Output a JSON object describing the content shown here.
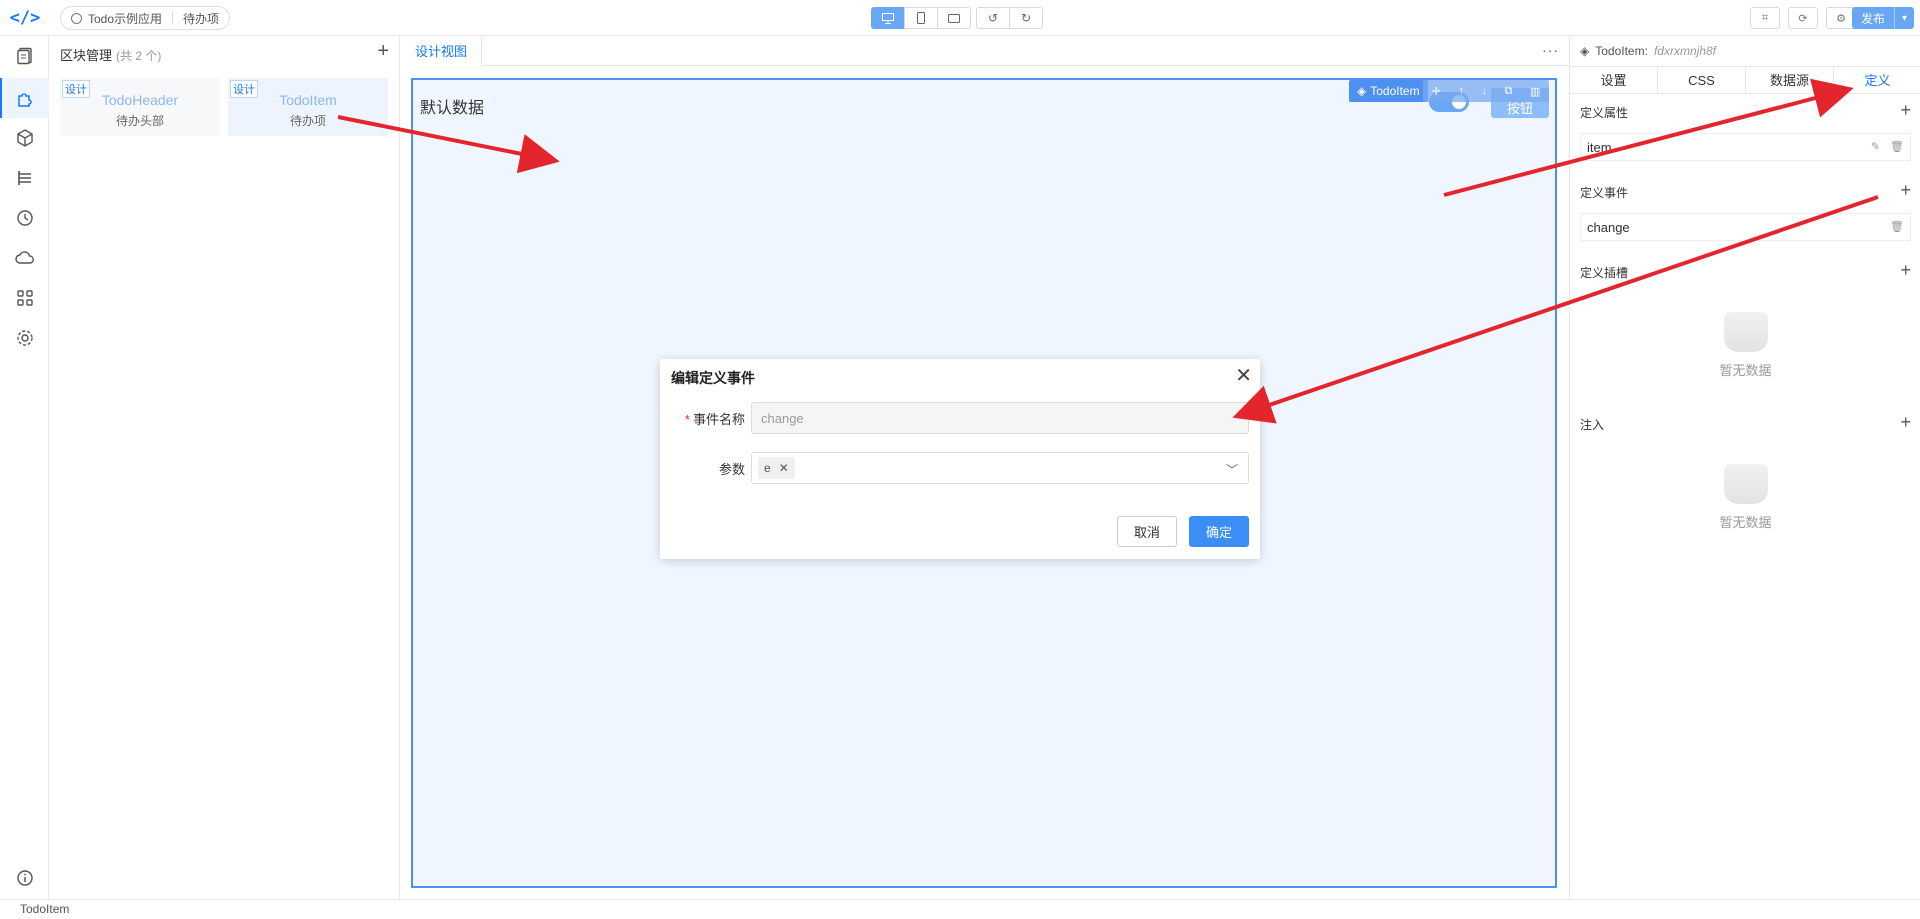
{
  "topbar": {
    "app_name": "Todo示例应用",
    "page_name": "待办项",
    "publish_label": "发布"
  },
  "blocks": {
    "title": "区块管理",
    "count": "(共 2 个)",
    "items": [
      {
        "tag": "设计",
        "name": "TodoHeader",
        "desc": "待办头部"
      },
      {
        "tag": "设计",
        "name": "TodoItem",
        "desc": "待办项"
      }
    ]
  },
  "canvas": {
    "tab": "设计视图",
    "default_text": "默认数据",
    "button_text": "按钮",
    "selection_label": "TodoItem"
  },
  "right_panel": {
    "component": "TodoItem:",
    "component_id": "fdxrxmnjh8f",
    "tabs": [
      "设置",
      "CSS",
      "数据源",
      "定义"
    ],
    "active_tab": "定义",
    "sections": {
      "props": "定义属性",
      "events": "定义事件",
      "slots": "定义插槽",
      "inject": "注入"
    },
    "prop_item": "item",
    "event_item": "change",
    "empty_text": "暂无数据"
  },
  "dialog": {
    "title": "编辑定义事件",
    "name_label": "事件名称",
    "name_value": "change",
    "params_label": "参数",
    "param_chip": "e",
    "cancel": "取消",
    "ok": "确定"
  },
  "status": {
    "text": "TodoItem"
  },
  "colors": {
    "accent": "#1677ff",
    "canvas_bg": "#f0f6ff",
    "arrow": "#e3262d"
  }
}
